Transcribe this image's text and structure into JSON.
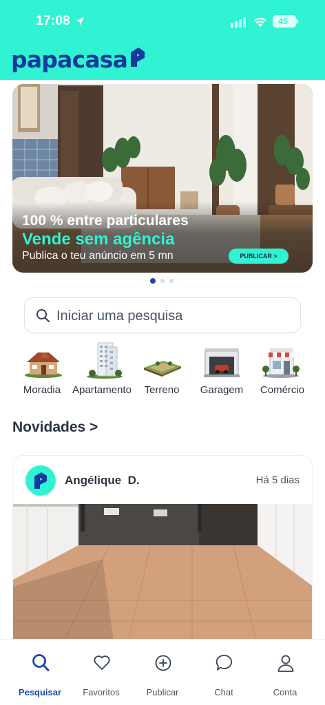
{
  "status_bar": {
    "time": "17:08",
    "battery": "45",
    "icons": [
      "location-arrow-icon",
      "signal-icon",
      "wifi-icon",
      "battery-icon"
    ]
  },
  "header": {
    "logo_text": "papacasa",
    "background_color": "#2ff3d3",
    "logo_color": "#16399d"
  },
  "banner": {
    "line1": "100 % entre particulares",
    "line2": "Vende sem agência",
    "line3": "Publica o teu anúncio em 5 mn",
    "cta": "PUBLICAR >",
    "carousel_pages": 3,
    "active_page": 1
  },
  "search": {
    "placeholder": "Iniciar uma pesquisa",
    "icon": "search-icon"
  },
  "categories": [
    {
      "label": "Moradia",
      "icon": "house-icon"
    },
    {
      "label": "Apartamento",
      "icon": "apartment-building-icon"
    },
    {
      "label": "Terreno",
      "icon": "land-plot-icon"
    },
    {
      "label": "Garagem",
      "icon": "garage-icon"
    },
    {
      "label": "Comércio",
      "icon": "shop-icon"
    }
  ],
  "news": {
    "title": "Novidades >",
    "cards": [
      {
        "author": "Angélique  D.",
        "posted": "Há 5 dias"
      }
    ]
  },
  "bottom_nav": {
    "active": "Pesquisar",
    "accent_color": "#1f46b4",
    "items": [
      {
        "label": "Pesquisar",
        "icon": "search-icon"
      },
      {
        "label": "Favoritos",
        "icon": "heart-icon"
      },
      {
        "label": "Publicar",
        "icon": "plus-circle-icon"
      },
      {
        "label": "Chat",
        "icon": "chat-bubble-icon"
      },
      {
        "label": "Conta",
        "icon": "user-icon"
      }
    ]
  }
}
